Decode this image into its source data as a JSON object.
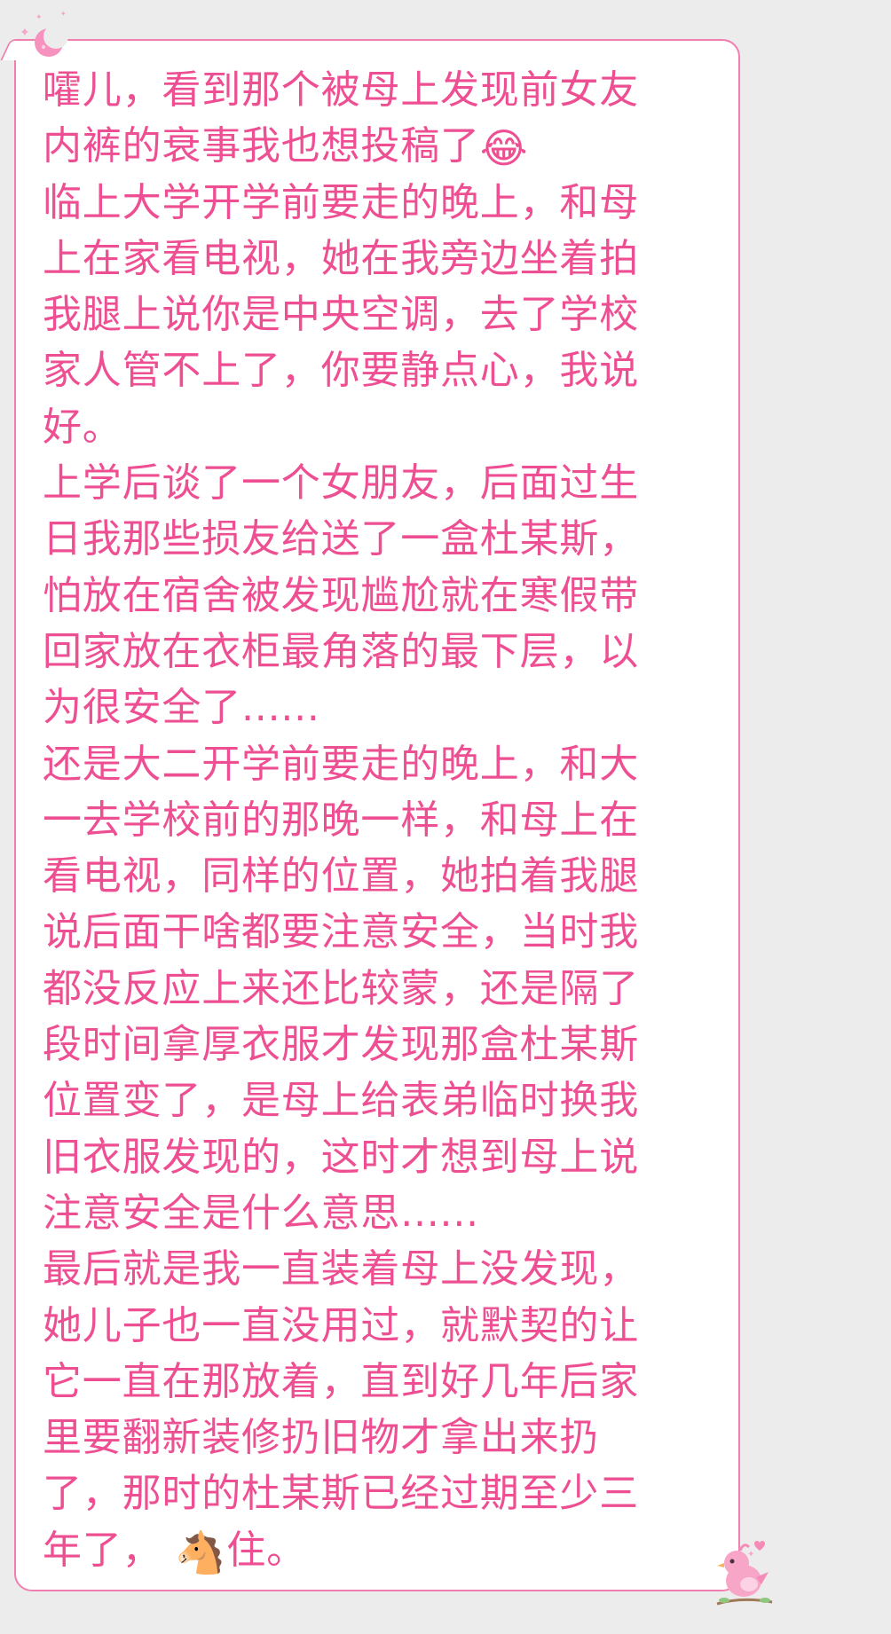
{
  "message": {
    "lines": [
      "嚯儿，看到那个被母上发现前女友",
      "内裤的衰事我也想投稿了",
      "临上大学开学前要走的晚上，和母",
      "上在家看电视，她在我旁边坐着拍",
      "我腿上说你是中央空调，去了学校",
      "家人管不上了，你要静点心，我说",
      "好。",
      "上学后谈了一个女朋友，后面过生",
      "日我那些损友给送了一盒杜某斯，",
      "怕放在宿舍被发现尴尬就在寒假带",
      "回家放在衣柜最角落的最下层，以",
      "为很安全了......",
      "还是大二开学前要走的晚上，和大",
      "一去学校前的那晚一样，和母上在",
      "看电视，同样的位置，她拍着我腿",
      "说后面干啥都要注意安全，当时我",
      "都没反应上来还比较蒙，还是隔了",
      "段时间拿厚衣服才发现那盒杜某斯",
      "位置变了，是母上给表弟临时换我",
      "旧衣服发现的，这时才想到母上说",
      "注意安全是什么意思......",
      "最后就是我一直装着母上没发现，",
      "她儿子也一直没用过，就默契的让",
      "它一直在那放着，直到好几年后家",
      "里要翻新装修扔旧物才拿出来扔",
      "了，那时的杜某斯已经过期至少三",
      "年了，",
      "住。"
    ],
    "emoji_laugh_cry": "😂",
    "emoji_horse": "🐴"
  },
  "colors": {
    "text": "#ee4f92",
    "border": "#f07fb0",
    "background": "#ececec",
    "bubble": "#ffffff"
  },
  "icons": [
    "moon-icon",
    "sparkle-icon",
    "bird-icon",
    "laugh-cry-emoji",
    "horse-emoji"
  ]
}
